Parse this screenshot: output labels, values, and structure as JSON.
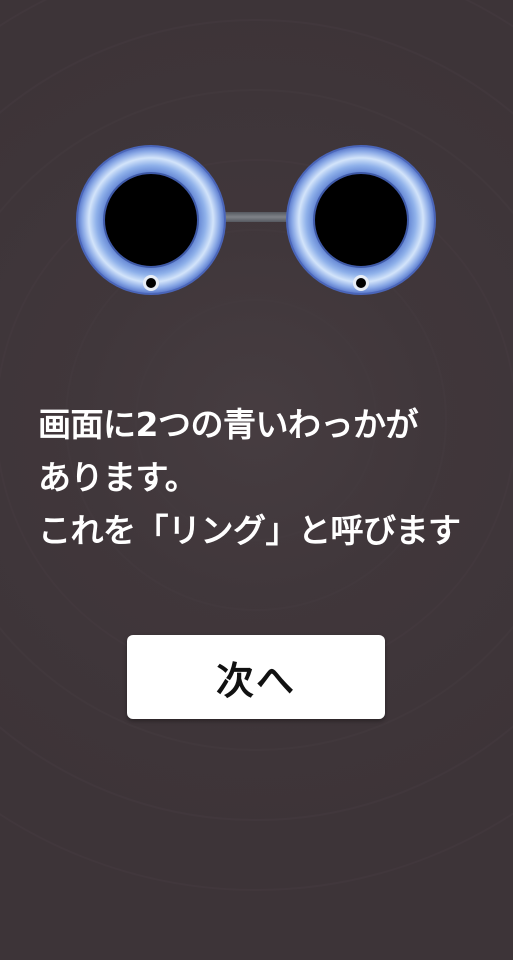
{
  "message": {
    "lines": [
      "画面に2つの青いわっかが",
      "あります。",
      "これを「リング」と呼びます"
    ]
  },
  "button": {
    "next_label": "次へ"
  },
  "rings": [
    {
      "name": "left-ring",
      "color": "#a8c6ee"
    },
    {
      "name": "right-ring",
      "color": "#a8c6ee"
    }
  ],
  "colors": {
    "background": "#3d3438",
    "ring_light": "#c9def7",
    "ring_mid": "#7d9fe0",
    "ring_center": "#000000",
    "connector": "#6f7379"
  }
}
